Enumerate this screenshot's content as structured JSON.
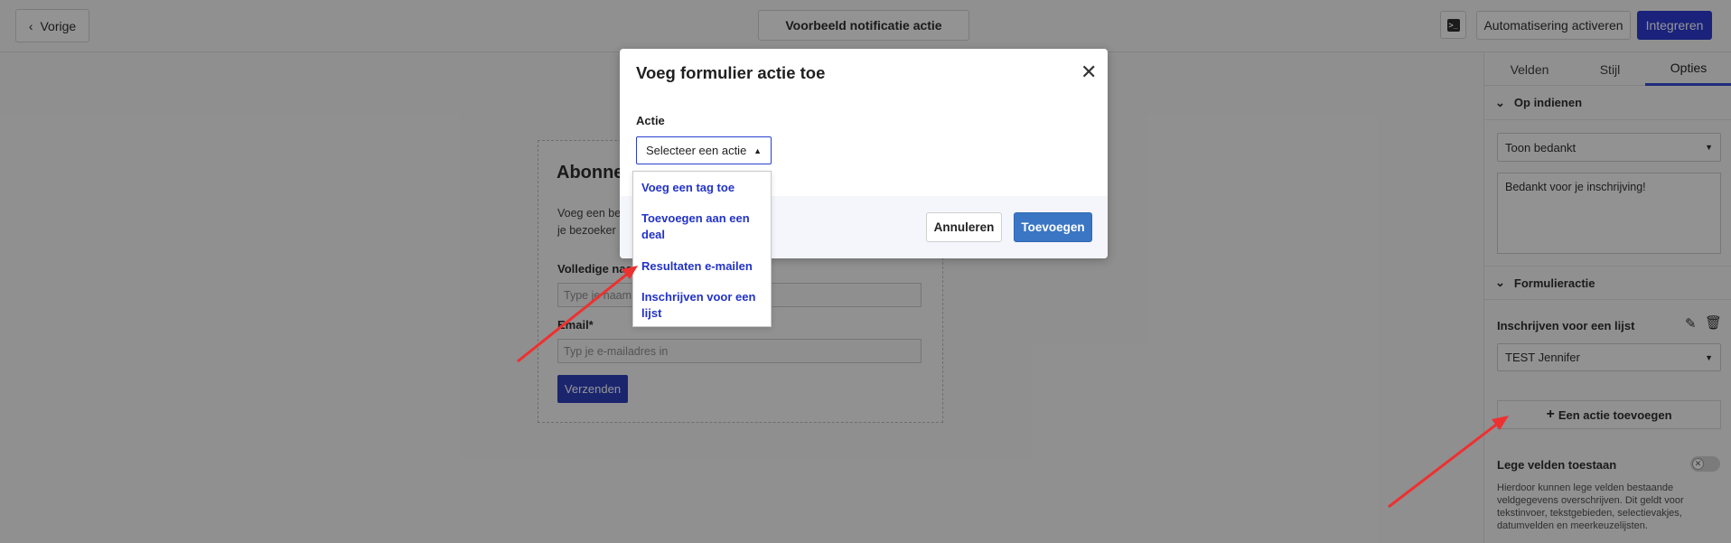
{
  "topbar": {
    "back_label": "Vorige",
    "preview_label": "Voorbeeld notificatie actie",
    "automation_label": "Automatisering activeren",
    "integrate_label": "Integreren"
  },
  "right_panel": {
    "tabs": [
      {
        "label": "Velden"
      },
      {
        "label": "Stijl"
      },
      {
        "label": "Opties"
      }
    ],
    "on_submit": {
      "heading": "Op indienen",
      "select_value": "Toon bedankt",
      "thank_you_text": "Bedankt voor je inschrijving!"
    },
    "form_action": {
      "heading": "Formulieractie",
      "action_name": "Inschrijven voor een lijst",
      "list_value": "TEST Jennifer",
      "add_action_label": "Een actie toevoegen"
    },
    "empty_fields": {
      "label": "Lege velden toestaan",
      "help": "Hierdoor kunnen lege velden bestaande veldgegevens overschrijven. Dit geldt voor tekstinvoer, tekstgebieden, selectievakjes, datumvelden en meerkeuzelijsten."
    }
  },
  "form_preview": {
    "title": "Abonne",
    "text_line1": "Voeg een be",
    "text_line2": "je bezoeker",
    "name_label": "Volledige naa",
    "name_placeholder": "Type je naam",
    "email_label": "Email*",
    "email_placeholder": "Typ je e-mailadres in",
    "submit_label": "Verzenden"
  },
  "modal": {
    "title": "Voeg formulier actie toe",
    "action_label": "Actie",
    "select_placeholder": "Selecteer een actie",
    "cancel_label": "Annuleren",
    "add_label": "Toevoegen",
    "options": [
      {
        "label": "Voeg een tag toe"
      },
      {
        "label": "Toevoegen aan een deal"
      },
      {
        "label": "Resultaten e-mailen"
      },
      {
        "label": "Inschrijven voor een lijst"
      }
    ]
  },
  "colors": {
    "primary": "#1f2fcf",
    "modal_add": "#3a76c4",
    "annotation_arrow": "#ee3030"
  }
}
